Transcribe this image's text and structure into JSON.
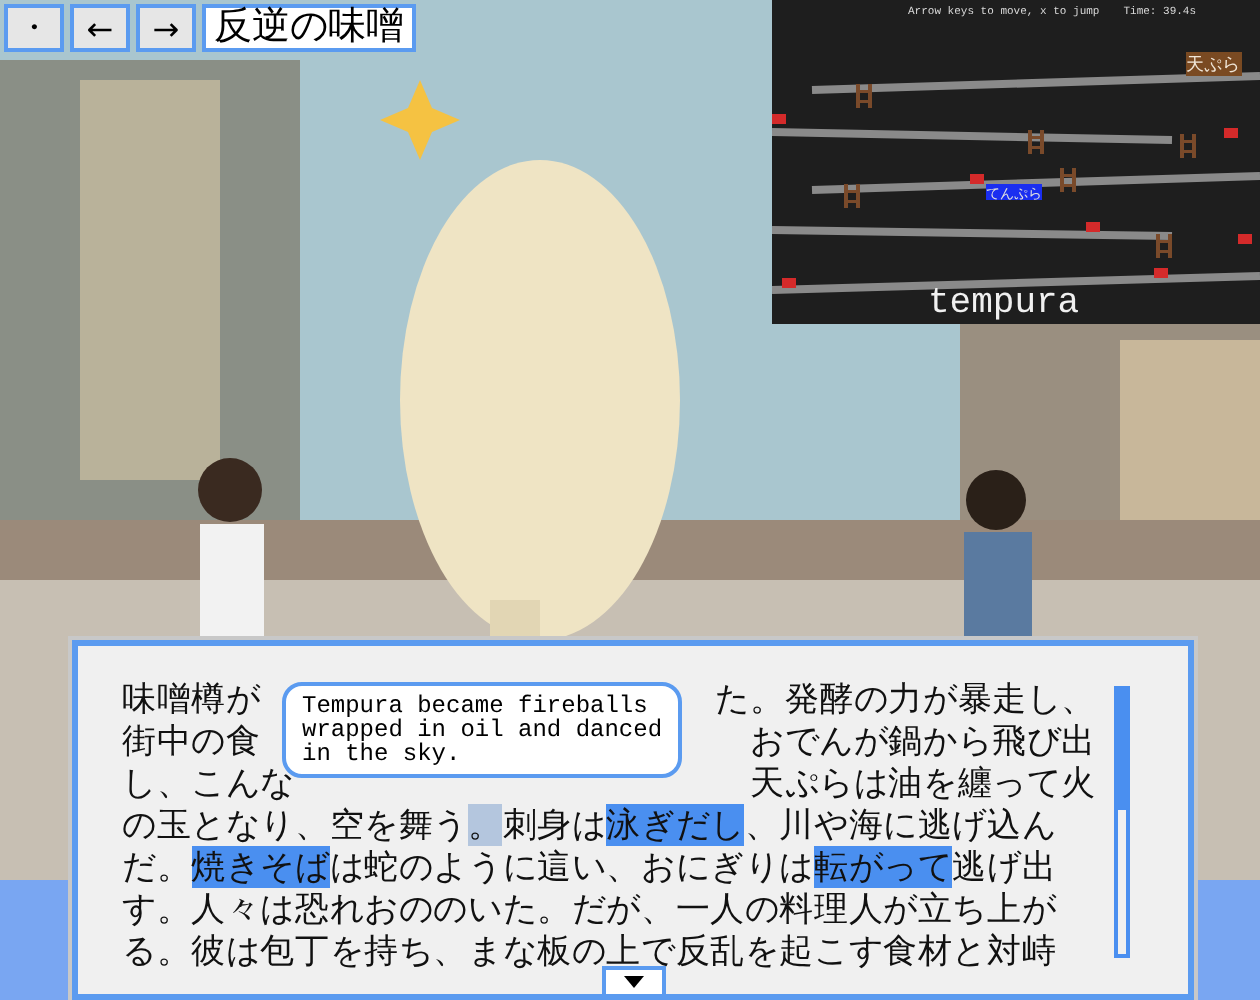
{
  "toolbar": {
    "buttons": [
      {
        "label": "・"
      },
      {
        "label": "←"
      },
      {
        "label": "→"
      }
    ],
    "title": "反逆の味噌"
  },
  "game": {
    "instructions": "Arrow keys to move, x to jump",
    "time": "Time: 39.4s",
    "goal_label": "天ぷら",
    "player_label": "てんぷら",
    "word": "tempura"
  },
  "story": {
    "lines": [
      {
        "segments": [
          {
            "text": "味噌樽が",
            "kind": "plain"
          },
          {
            "text": "た。発酵の力が暴走し、",
            "kind": "plain"
          }
        ]
      },
      {
        "segments": [
          {
            "text": "街中の食",
            "kind": "plain"
          },
          {
            "text": "おでんが鍋から飛び出",
            "kind": "plain"
          }
        ]
      },
      {
        "segments": [
          {
            "text": "し、こんな",
            "kind": "plain"
          },
          {
            "text": "天ぷらは油を纏って火",
            "kind": "plain"
          }
        ]
      },
      {
        "segments": [
          {
            "text": "の玉となり、空を舞う",
            "kind": "plain"
          },
          {
            "text": "。",
            "kind": "soft"
          },
          {
            "text": "刺身は",
            "kind": "plain"
          },
          {
            "text": "泳ぎだし",
            "kind": "marked"
          },
          {
            "text": "、川や海に逃げ込ん",
            "kind": "plain"
          }
        ]
      },
      {
        "segments": [
          {
            "text": "だ。",
            "kind": "plain"
          },
          {
            "text": "焼きそば",
            "kind": "marked"
          },
          {
            "text": "は蛇のように這い、おにぎりは",
            "kind": "plain"
          },
          {
            "text": "転がって",
            "kind": "marked"
          },
          {
            "text": "逃げ出",
            "kind": "plain"
          }
        ]
      },
      {
        "segments": [
          {
            "text": "す。人々は恐れおののいた。だが、一人の料理人が立ち上が",
            "kind": "plain"
          }
        ]
      },
      {
        "segments": [
          {
            "text": "る。彼は包丁を持ち、まな板の上で反乱を起こす食材と対峙",
            "kind": "plain"
          }
        ]
      }
    ],
    "tooltip": "Tempura became fireballs wrapped in oil and danced in the sky."
  }
}
